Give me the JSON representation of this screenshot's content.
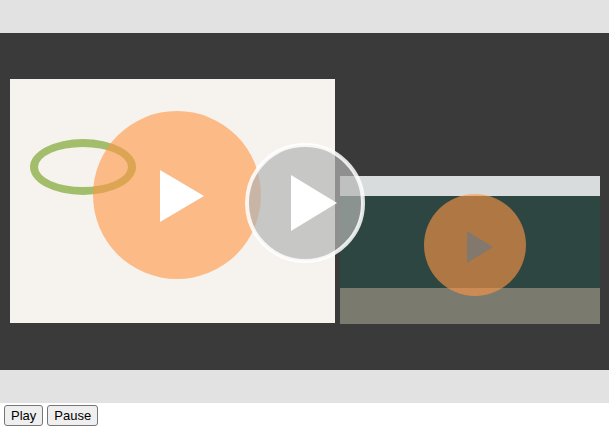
{
  "player": {
    "playing": false
  },
  "buttons": [
    {
      "label": "Play"
    },
    {
      "label": "Pause"
    }
  ]
}
